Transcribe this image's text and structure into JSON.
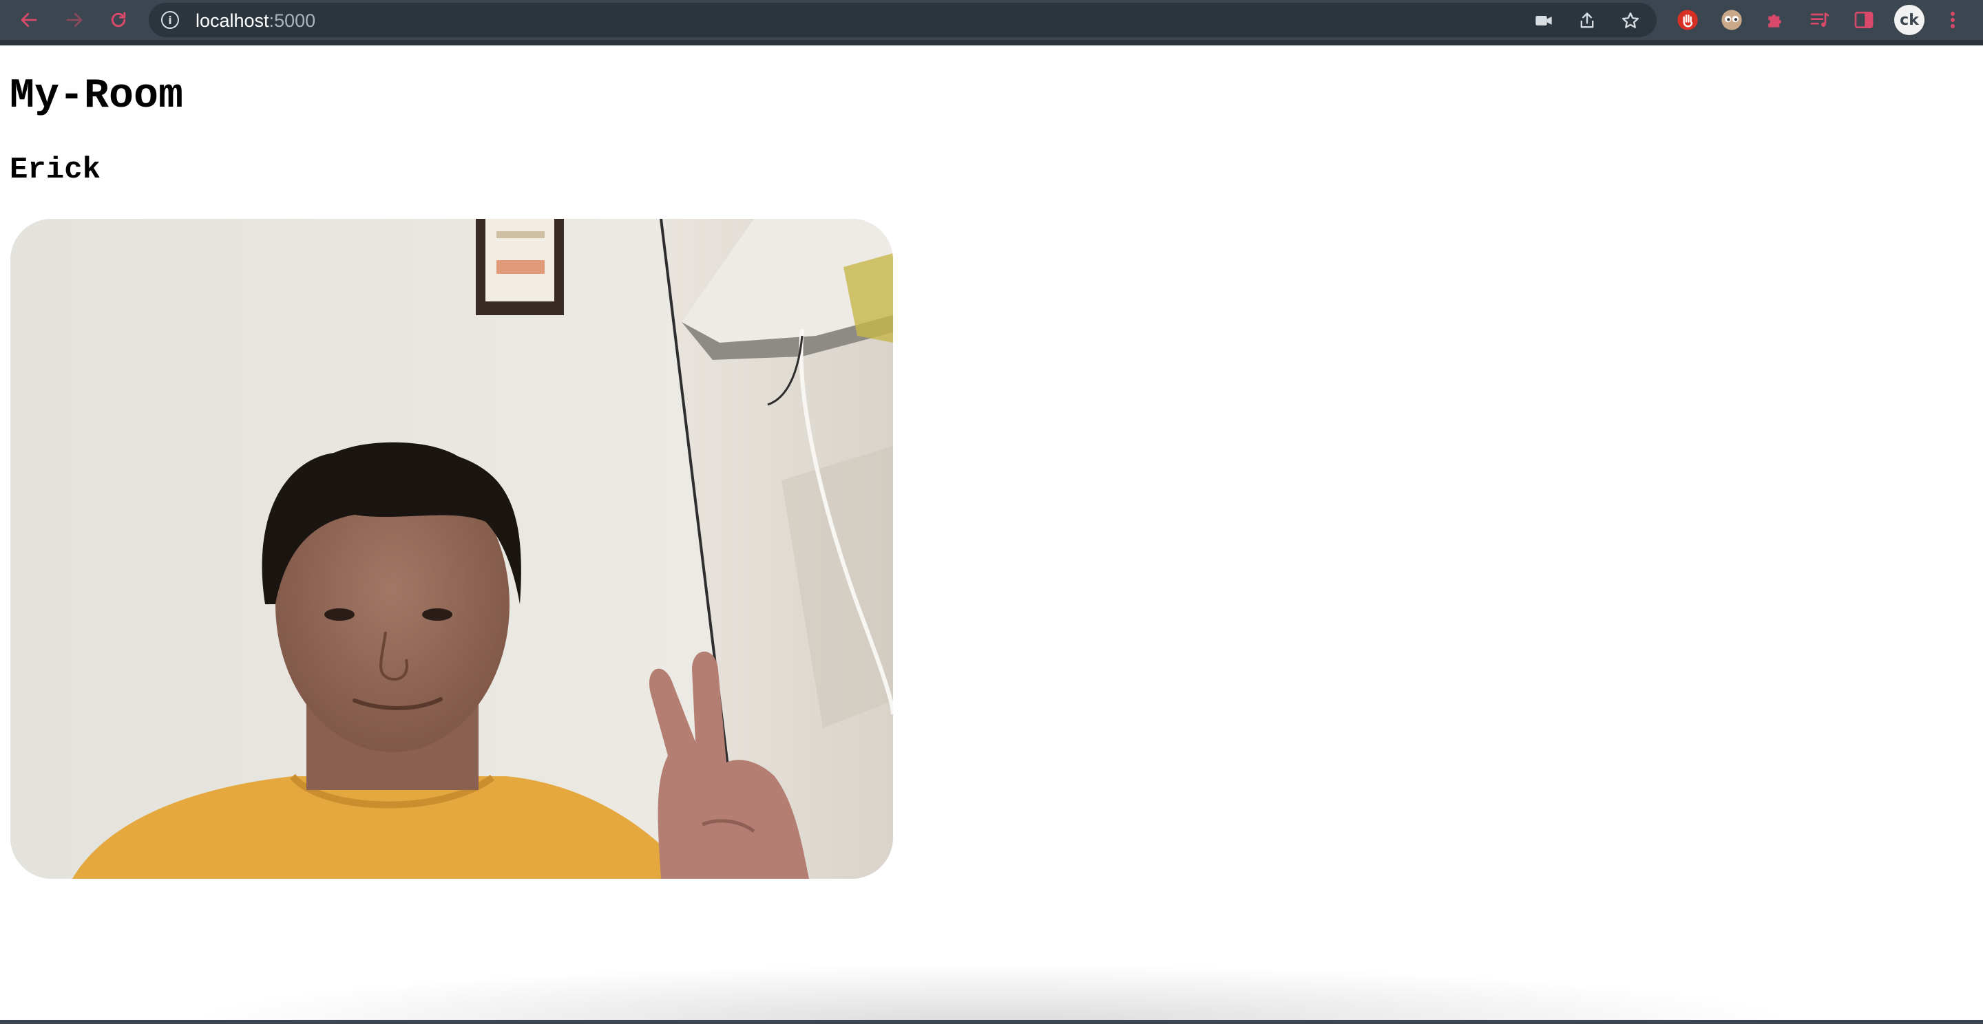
{
  "browser": {
    "url_host": "localhost",
    "url_port": ":5000",
    "avatar_initials": "ck",
    "accent_color": "#d94a6a",
    "icons": [
      "back-arrow-icon",
      "forward-arrow-icon",
      "reload-icon",
      "info-icon",
      "camera-icon",
      "share-icon",
      "star-icon",
      "stop-hand-extension-icon",
      "eyes-extension-icon",
      "puzzle-extensions-icon",
      "media-queue-icon",
      "side-panel-icon",
      "kebab-menu-icon"
    ]
  },
  "page": {
    "title": "My-Room",
    "participant_name": "Erick"
  }
}
